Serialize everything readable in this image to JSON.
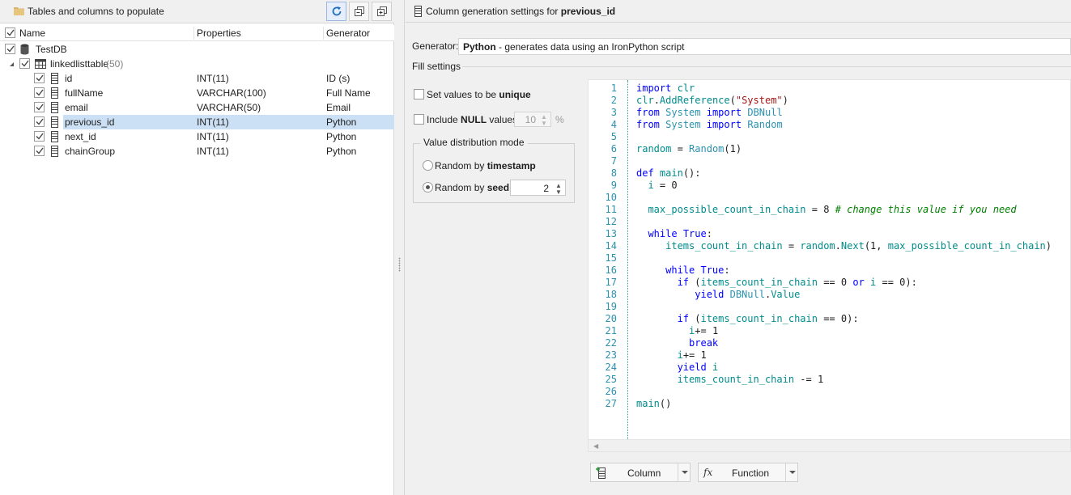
{
  "left_panel": {
    "title": "Tables and columns to populate",
    "columns": {
      "name": "Name",
      "properties": "Properties",
      "generator": "Generator"
    },
    "database": {
      "name": "TestDB"
    },
    "table": {
      "name": "linkedlisttable",
      "count": "(50)"
    },
    "rows": [
      {
        "name": "id",
        "properties": "INT(11)",
        "generator": "ID (s)",
        "selected": false
      },
      {
        "name": "fullName",
        "properties": "VARCHAR(100)",
        "generator": "Full Name",
        "selected": false
      },
      {
        "name": "email",
        "properties": "VARCHAR(50)",
        "generator": "Email",
        "selected": false
      },
      {
        "name": "previous_id",
        "properties": "INT(11)",
        "generator": "Python",
        "selected": true
      },
      {
        "name": "next_id",
        "properties": "INT(11)",
        "generator": "Python",
        "selected": false
      },
      {
        "name": "chainGroup",
        "properties": "INT(11)",
        "generator": "Python",
        "selected": false
      }
    ],
    "toolbar_icons": [
      "refresh-icon",
      "collapse-all-icon",
      "expand-all-icon"
    ]
  },
  "right_panel": {
    "title_prefix": "Column generation settings for ",
    "title_column": "previous_id",
    "generator_label": "Generator:",
    "generator_name": "Python",
    "generator_desc": " - generates data using an IronPython script",
    "fill_settings_label": "Fill settings",
    "unique_prefix": "Set values to be ",
    "unique_bold": "unique",
    "null_prefix": "Include ",
    "null_bold": "NULL",
    "null_suffix": " values",
    "null_percent": "10",
    "percent_sign": "%",
    "distribution_title": "Value distribution mode",
    "random_timestamp_prefix": "Random by ",
    "random_timestamp_bold": "timestamp",
    "random_seed_prefix": "Random by ",
    "random_seed_bold": "seed",
    "seed_value": "2",
    "selected_distribution": "seed"
  },
  "editor": {
    "lines": [
      "import clr",
      "clr.AddReference(\"System\")",
      "from System import DBNull",
      "from System import Random",
      "",
      "random = Random(1)",
      "",
      "def main():",
      "  i = 0",
      "",
      "  max_possible_count_in_chain = 8 # change this value if you need",
      "",
      "  while True:",
      "     items_count_in_chain = random.Next(1, max_possible_count_in_chain)",
      "",
      "     while True:",
      "       if (items_count_in_chain == 0 or i == 0):",
      "          yield DBNull.Value",
      "",
      "       if (items_count_in_chain == 0):",
      "         i+= 1",
      "         break",
      "       i+= 1",
      "       yield i",
      "       items_count_in_chain -= 1",
      "",
      "main()"
    ]
  },
  "bottom_buttons": {
    "column_label": "Column",
    "function_label": "Function",
    "function_icon_text": "fx"
  },
  "colors": {
    "selection": "#cce0f5",
    "keyword": "#0000ff",
    "type": "#2b91af",
    "string": "#a31515",
    "comment": "#008000",
    "identifier": "#008b8b"
  }
}
